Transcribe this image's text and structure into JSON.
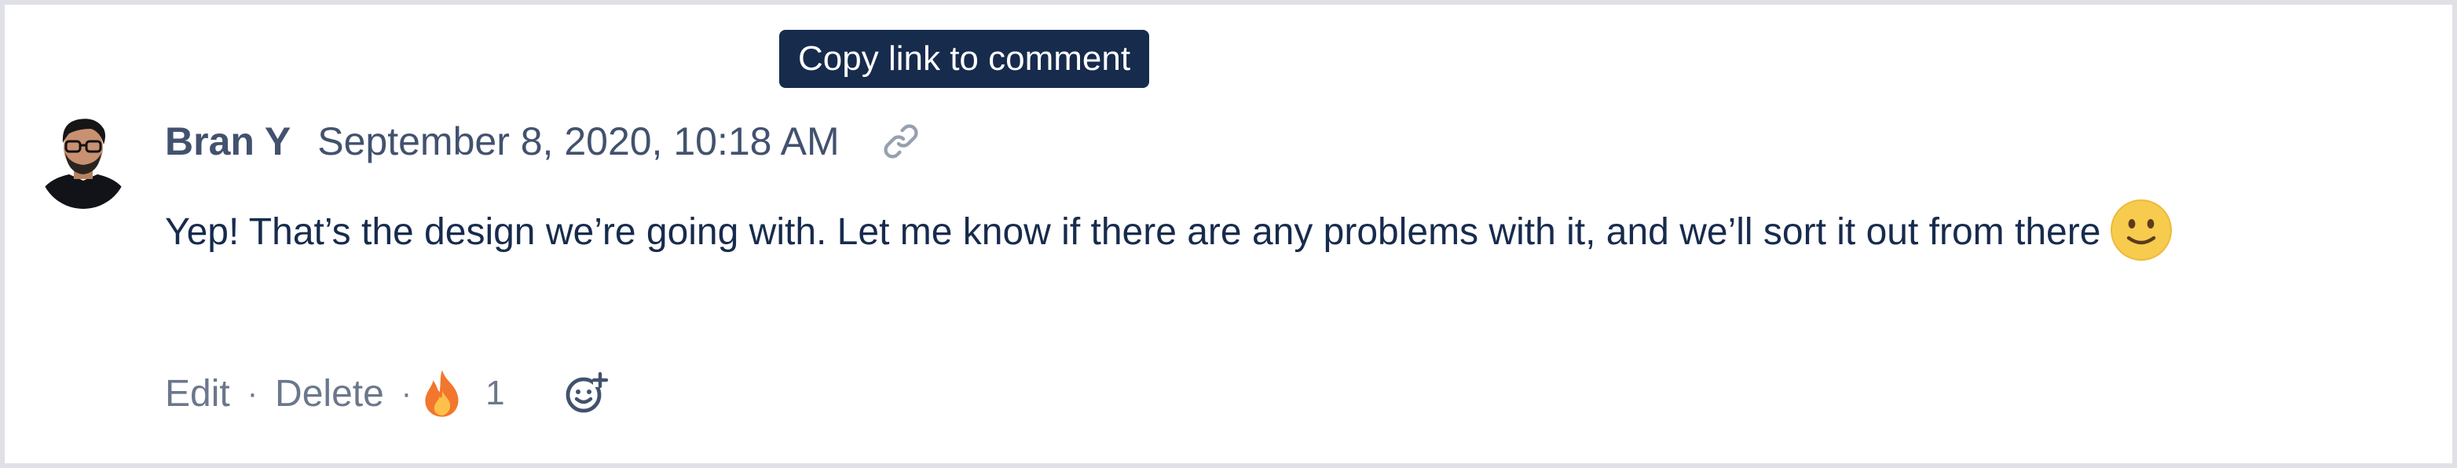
{
  "tooltip": {
    "text": "Copy link to comment"
  },
  "comment": {
    "author": "Bran Y",
    "timestamp": "September 8, 2020, 10:18 AM",
    "body": "Yep! That’s the design we’re going with. Let me know if there are any problems with it, and we’ll sort it out from there",
    "inline_emoji": "slightly-smiling-face-icon"
  },
  "actions": {
    "edit_label": "Edit",
    "delete_label": "Delete",
    "separator": "·",
    "reaction_emoji": "fire-icon",
    "reaction_count": "1",
    "add_reaction_icon": "add-reaction-icon"
  },
  "colors": {
    "tooltip_bg": "#172b4d",
    "text_primary": "#172b4d",
    "text_meta": "#42526e",
    "text_subtle": "#6b778c",
    "border": "#dfe1e6"
  }
}
